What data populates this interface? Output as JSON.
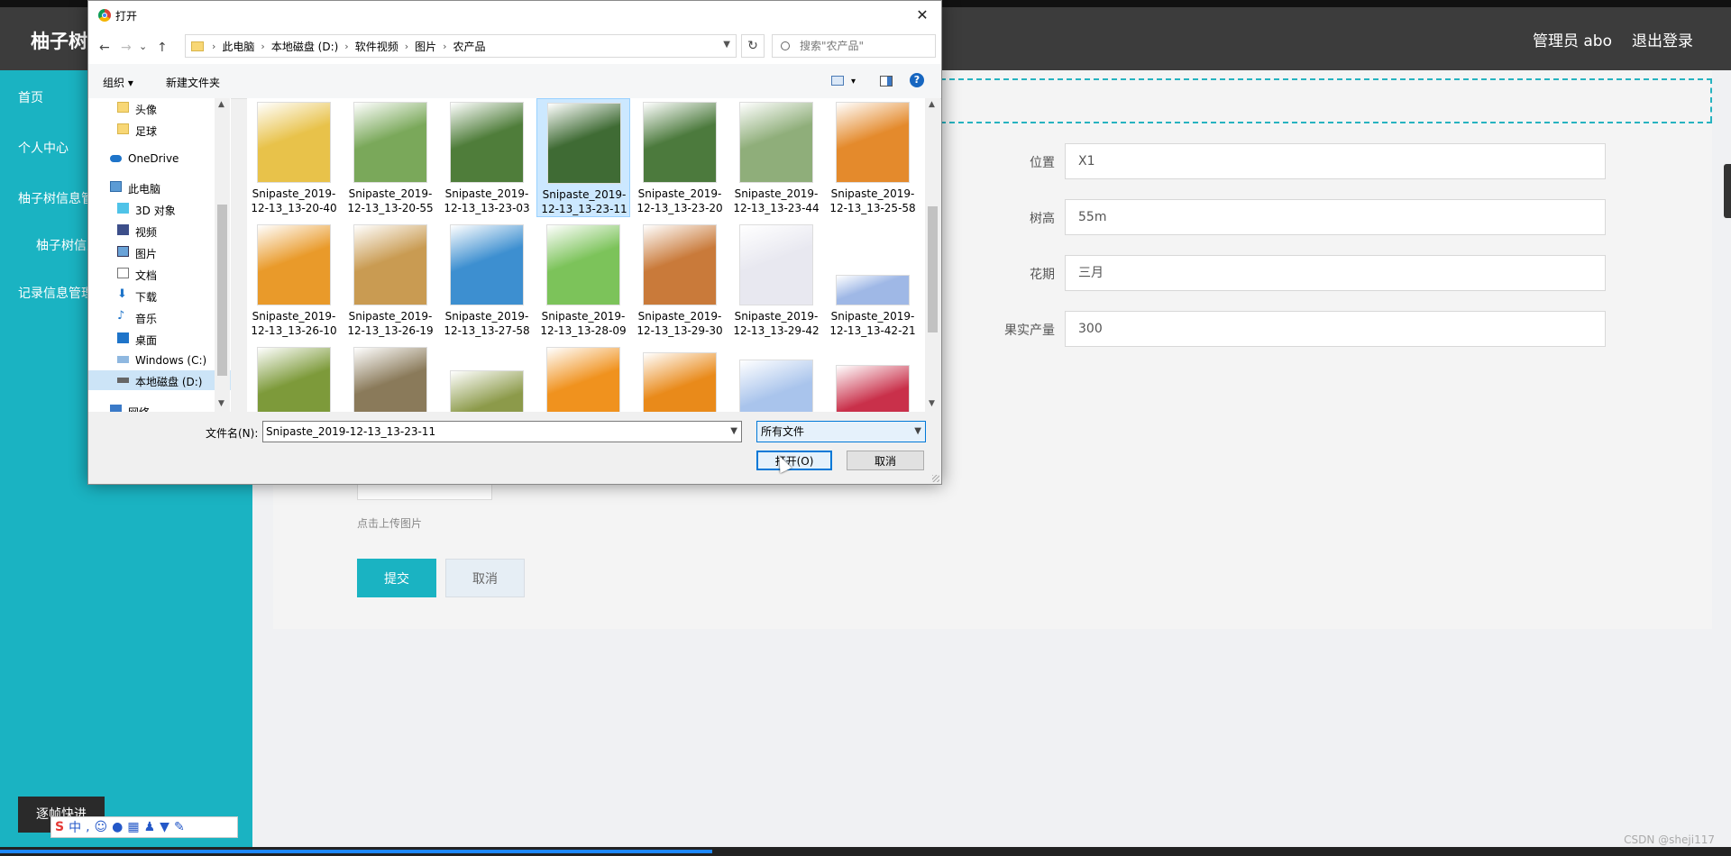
{
  "app": {
    "brand": "柚子树管理系统",
    "header_user": "管理员 abo",
    "logout": "退出登录"
  },
  "sidebar": {
    "items": [
      {
        "label": "首页"
      },
      {
        "label": "个人中心"
      },
      {
        "label": "柚子树信息管理"
      },
      {
        "label": "柚子树信息"
      },
      {
        "label": "记录信息管理"
      }
    ]
  },
  "form": {
    "fields": [
      {
        "label": "位置",
        "value": "X1"
      },
      {
        "label": "树高",
        "value": "55m"
      },
      {
        "label": "花期",
        "value": "三月"
      },
      {
        "label": "果实产量",
        "value": "300"
      }
    ],
    "upload_hint": "点击上传图片",
    "submit": "提交",
    "cancel": "取消"
  },
  "dialog": {
    "title": "打开",
    "close": "✕",
    "nav": {
      "back": "←",
      "forward": "→",
      "history": "⌄",
      "up": "↑"
    },
    "breadcrumbs": [
      "此电脑",
      "本地磁盘 (D:)",
      "软件视频",
      "图片",
      "农产品"
    ],
    "refresh": "↻",
    "search_placeholder": "搜索\"农产品\"",
    "toolbar": {
      "organize": "组织 ▾",
      "new_folder": "新建文件夹",
      "view_drop": "▾",
      "help": "?"
    },
    "nav_tree": [
      {
        "label": "头像",
        "icon": "folder-icon"
      },
      {
        "label": "足球",
        "icon": "folder-icon"
      },
      {
        "label": "OneDrive",
        "icon": "cloud-icon"
      },
      {
        "label": "此电脑",
        "icon": "computer-icon"
      },
      {
        "label": "3D 对象",
        "icon": "cube-icon"
      },
      {
        "label": "视频",
        "icon": "video-icon"
      },
      {
        "label": "图片",
        "icon": "picture-icon"
      },
      {
        "label": "文档",
        "icon": "document-icon"
      },
      {
        "label": "下载",
        "icon": "download-icon"
      },
      {
        "label": "音乐",
        "icon": "music-icon"
      },
      {
        "label": "桌面",
        "icon": "desktop-icon"
      },
      {
        "label": "Windows (C:)",
        "icon": "drive-icon"
      },
      {
        "label": "本地磁盘 (D:)",
        "icon": "drive-icon"
      },
      {
        "label": "网络",
        "icon": "network-icon"
      }
    ],
    "files": [
      {
        "line1": "Snipaste_2019-",
        "line2": "12-13_13-20-40",
        "color": "#e8c24a"
      },
      {
        "line1": "Snipaste_2019-",
        "line2": "12-13_13-20-55",
        "color": "#7aa85a"
      },
      {
        "line1": "Snipaste_2019-",
        "line2": "12-13_13-23-03",
        "color": "#4f7d3a"
      },
      {
        "line1": "Snipaste_2019-",
        "line2": "12-13_13-23-11",
        "color": "#3f6b34"
      },
      {
        "line1": "Snipaste_2019-",
        "line2": "12-13_13-23-20",
        "color": "#4c7a3d"
      },
      {
        "line1": "Snipaste_2019-",
        "line2": "12-13_13-23-44",
        "color": "#8fae7a"
      },
      {
        "line1": "Snipaste_2019-",
        "line2": "12-13_13-25-58",
        "color": "#e48a2c"
      },
      {
        "line1": "Snipaste_2019-",
        "line2": "12-13_13-26-10",
        "color": "#e99a2a"
      },
      {
        "line1": "Snipaste_2019-",
        "line2": "12-13_13-26-19",
        "color": "#c99b52"
      },
      {
        "line1": "Snipaste_2019-",
        "line2": "12-13_13-27-58",
        "color": "#3d8fd0"
      },
      {
        "line1": "Snipaste_2019-",
        "line2": "12-13_13-28-09",
        "color": "#7cc35a"
      },
      {
        "line1": "Snipaste_2019-",
        "line2": "12-13_13-29-30",
        "color": "#c97a3a"
      },
      {
        "line1": "Snipaste_2019-",
        "line2": "12-13_13-29-42",
        "color": "#e8e8f0"
      },
      {
        "line1": "Snipaste_2019-",
        "line2": "12-13_13-42-21",
        "color": "#9fb8e6"
      },
      {
        "line1": "",
        "line2": "",
        "color": "#7d9a3a"
      },
      {
        "line1": "",
        "line2": "",
        "color": "#8a7a5a"
      },
      {
        "line1": "",
        "line2": "",
        "color": "#8c9a4a"
      },
      {
        "line1": "",
        "line2": "",
        "color": "#f0921e"
      },
      {
        "line1": "",
        "line2": "",
        "color": "#e98a1a"
      },
      {
        "line1": "",
        "line2": "",
        "color": "#a9c4ec"
      },
      {
        "line1": "",
        "line2": "",
        "color": "#c9304a"
      }
    ],
    "filename_label": "文件名(N):",
    "filename_value": "Snipaste_2019-12-13_13-23-11",
    "filetype": "所有文件",
    "open": "打开(O)",
    "cancel": "取消"
  },
  "ime": {
    "label": "中"
  },
  "fast_button": "逐帧快进",
  "watermark": "CSDN @sheji117"
}
